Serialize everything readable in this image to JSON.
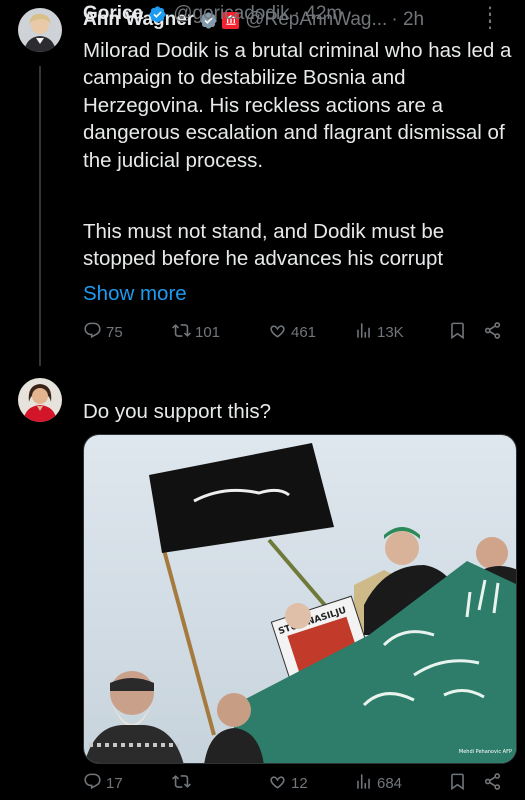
{
  "tweets": [
    {
      "name": "Ann Wagner",
      "handle": "@RepAnnWag...",
      "time": "· 2h",
      "text": "Milorad Dodik is a brutal criminal who has led a campaign to destabilize Bosnia and Herzegovina.  His reckless actions are a dangerous escalation and flagrant dismissal of the judicial process.",
      "text2": "This must not stand, and Dodik must be stopped before he advances his corrupt",
      "show_more": "Show more",
      "stats": {
        "replies": "75",
        "reposts": "101",
        "likes": "461",
        "views": "13K"
      }
    },
    {
      "name": "Gorica",
      "handle": "@goricadodik",
      "time": "· 42m",
      "text": "Do you support this?",
      "media": {
        "sign_text": "STOP NASILJU",
        "credit": "Mehdi Pehanovic AFP"
      },
      "stats": {
        "replies": "17",
        "reposts": "",
        "likes": "12",
        "views": "684"
      }
    }
  ],
  "colors": {
    "accent": "#1d9bf0",
    "muted": "#71767b",
    "text": "#e7e9ea",
    "background": "#000000",
    "gov_badge": "#f4212e"
  },
  "icons": [
    "verified-icon",
    "government-label-icon",
    "more-icon",
    "reply-icon",
    "repost-icon",
    "like-icon",
    "views-icon",
    "bookmark-icon",
    "share-icon"
  ]
}
